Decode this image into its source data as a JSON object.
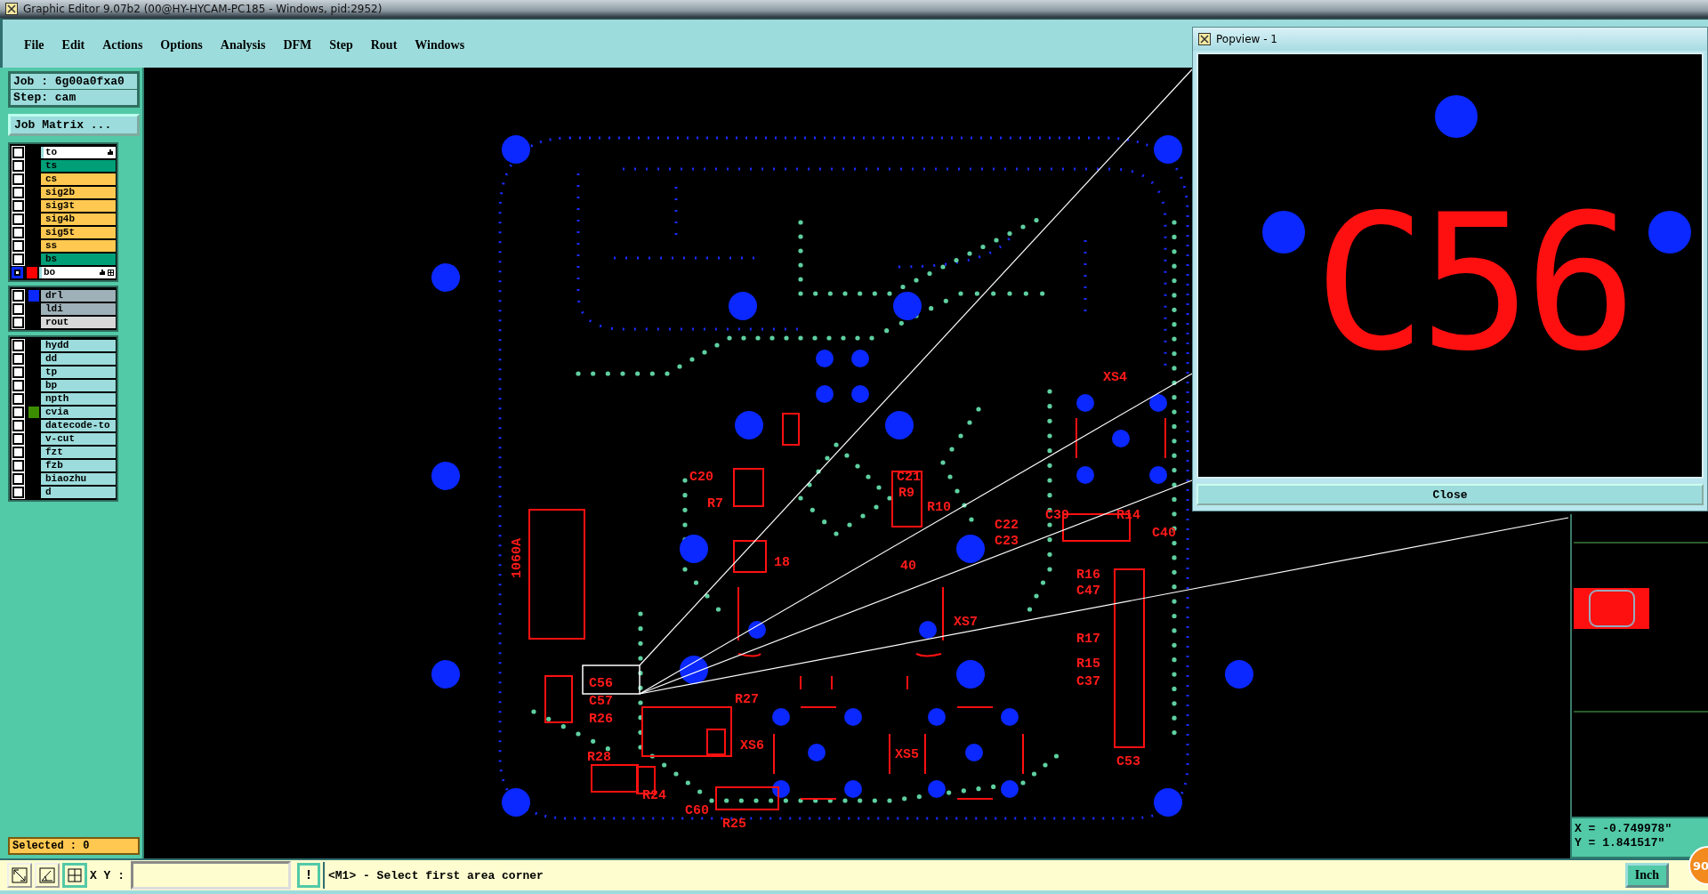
{
  "window": {
    "title": "Graphic Editor 9.07b2 (00@HY-HYCAM-PC185 - Windows, pid:2952)"
  },
  "menu": [
    "File",
    "Edit",
    "Actions",
    "Options",
    "Analysis",
    "DFM",
    "Step",
    "Rout",
    "Windows"
  ],
  "job": {
    "job": "Job : 6g00a0fxa0",
    "step": "Step: cam",
    "matrix_button": "Job Matrix ..."
  },
  "layer_groups": [
    {
      "layers": [
        {
          "name": "to",
          "kind": "silk",
          "affected": true,
          "work": false
        },
        {
          "name": "ts",
          "kind": "mask",
          "affected": false,
          "work": false
        },
        {
          "name": "cs",
          "kind": "signal",
          "affected": false,
          "work": false
        },
        {
          "name": "sig2b",
          "kind": "signal",
          "affected": false,
          "work": false
        },
        {
          "name": "sig3t",
          "kind": "signal",
          "affected": false,
          "work": false
        },
        {
          "name": "sig4b",
          "kind": "signal",
          "affected": false,
          "work": false
        },
        {
          "name": "sig5t",
          "kind": "signal",
          "affected": false,
          "work": false
        },
        {
          "name": "ss",
          "kind": "signal",
          "affected": false,
          "work": false
        },
        {
          "name": "bs",
          "kind": "mask",
          "affected": false,
          "work": false
        },
        {
          "name": "bo",
          "kind": "silk",
          "affected": true,
          "work": true,
          "color": "#ff0000"
        }
      ]
    },
    {
      "layers": [
        {
          "name": "drl",
          "kind": "drill",
          "affected": false,
          "work": false,
          "color": "#0a28ff"
        },
        {
          "name": "ldi",
          "kind": "drill",
          "affected": false,
          "work": false
        },
        {
          "name": "rout",
          "kind": "rout",
          "affected": false,
          "work": false
        }
      ]
    },
    {
      "layers": [
        {
          "name": "hydd",
          "kind": "doc",
          "affected": false,
          "work": false
        },
        {
          "name": "dd",
          "kind": "doc",
          "affected": false,
          "work": false
        },
        {
          "name": "tp",
          "kind": "doc",
          "affected": false,
          "work": false
        },
        {
          "name": "bp",
          "kind": "doc",
          "affected": false,
          "work": false
        },
        {
          "name": "npth",
          "kind": "doc",
          "affected": false,
          "work": false
        },
        {
          "name": "cvia",
          "kind": "doc",
          "affected": false,
          "work": false,
          "color": "#3c8c00"
        },
        {
          "name": "datecode-to",
          "kind": "doc",
          "affected": false,
          "work": false
        },
        {
          "name": "v-cut",
          "kind": "doc",
          "affected": false,
          "work": false
        },
        {
          "name": "fzt",
          "kind": "doc",
          "affected": false,
          "work": false
        },
        {
          "name": "fzb",
          "kind": "doc",
          "affected": false,
          "work": false
        },
        {
          "name": "biaozhu",
          "kind": "doc",
          "affected": false,
          "work": false
        },
        {
          "name": "d",
          "kind": "doc",
          "affected": false,
          "work": false
        }
      ]
    }
  ],
  "selected": "Selected : 0",
  "board": {
    "labels": [
      "C56",
      "C57",
      "R26",
      "C20",
      "R7",
      "C21",
      "R9",
      "R10",
      "XS4",
      "C39",
      "R14",
      "C40",
      "C22",
      "C23",
      "R16",
      "C47",
      "R17",
      "R15",
      "C37",
      "C53",
      "R27",
      "R28",
      "R24",
      "C60",
      "R25",
      "XS5",
      "XS6",
      "XS7",
      "1060A",
      "18",
      "40"
    ]
  },
  "popview": {
    "title": "Popview - 1",
    "label": "C56",
    "close": "Close"
  },
  "readout": {
    "x": "X = -0.749978\"",
    "y": "Y = 1.841517\""
  },
  "status": {
    "xy_label": "X Y :",
    "info_button": "!",
    "prompt": "<M1> - Select first area corner",
    "units": "Inch"
  },
  "badge": "90"
}
